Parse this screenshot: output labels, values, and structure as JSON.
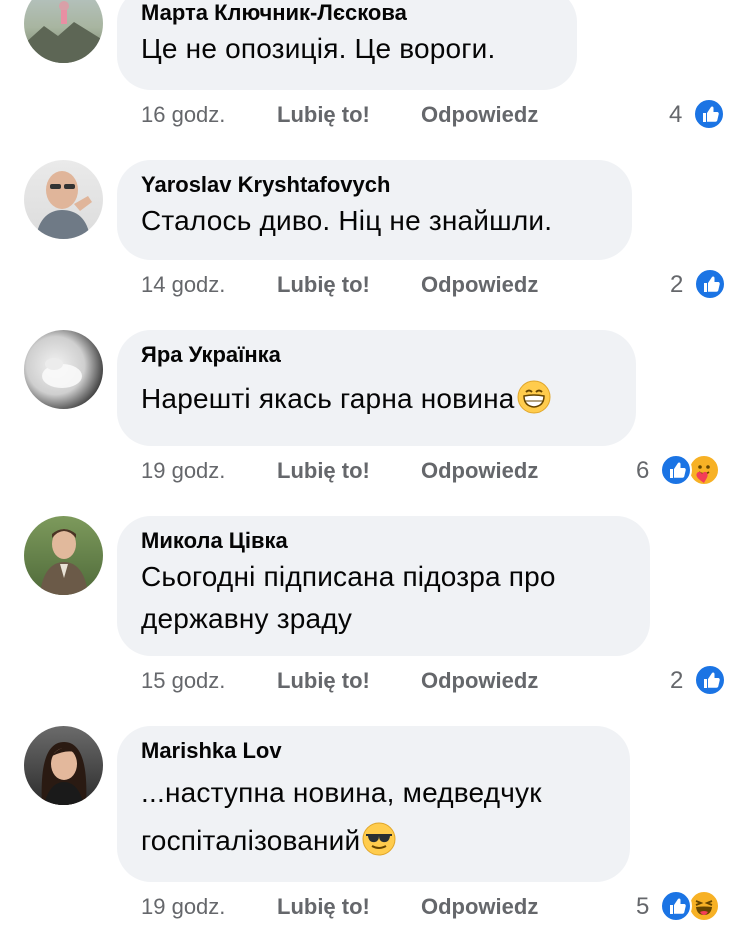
{
  "labels": {
    "like": "Lubię to!",
    "reply": "Odpowiedz"
  },
  "colors": {
    "like_blue": "#1b74e4",
    "emoji_yellow": "#f7b125",
    "bubble": "#f0f2f5",
    "meta_gray": "#65676b"
  },
  "comments": [
    {
      "author": "Марта Ключник-Лєскова",
      "text": "Це не опозиція. Це вороги.",
      "time": "16 godz.",
      "reactions": "4",
      "reaction_icons": [
        "like-icon"
      ]
    },
    {
      "author": "Yaroslav Kryshtafovych",
      "text": "Сталось диво. Ніц не знайшли.",
      "time": "14 godz.",
      "reactions": "2",
      "reaction_icons": [
        "like-icon"
      ]
    },
    {
      "author": "Яра Українка",
      "text": "Нарешті якась гарна новина",
      "text_emoji": "grinning-face-icon",
      "time": "19 godz.",
      "reactions": "6",
      "reaction_icons": [
        "like-icon",
        "care-icon"
      ]
    },
    {
      "author": "Микола Цівка",
      "text_line1": "Сьогодні підписана підозра про",
      "text_line2": "державну зраду",
      "time": "15 godz.",
      "reactions": "2",
      "reaction_icons": [
        "like-icon"
      ]
    },
    {
      "author": "Marishka Lov",
      "text_line1": "...наступна новина, медведчук",
      "text_line2": "госпіталізований",
      "text_emoji": "sunglasses-face-icon",
      "time": "19 godz.",
      "reactions": "5",
      "reaction_icons": [
        "like-icon",
        "haha-icon"
      ]
    }
  ]
}
